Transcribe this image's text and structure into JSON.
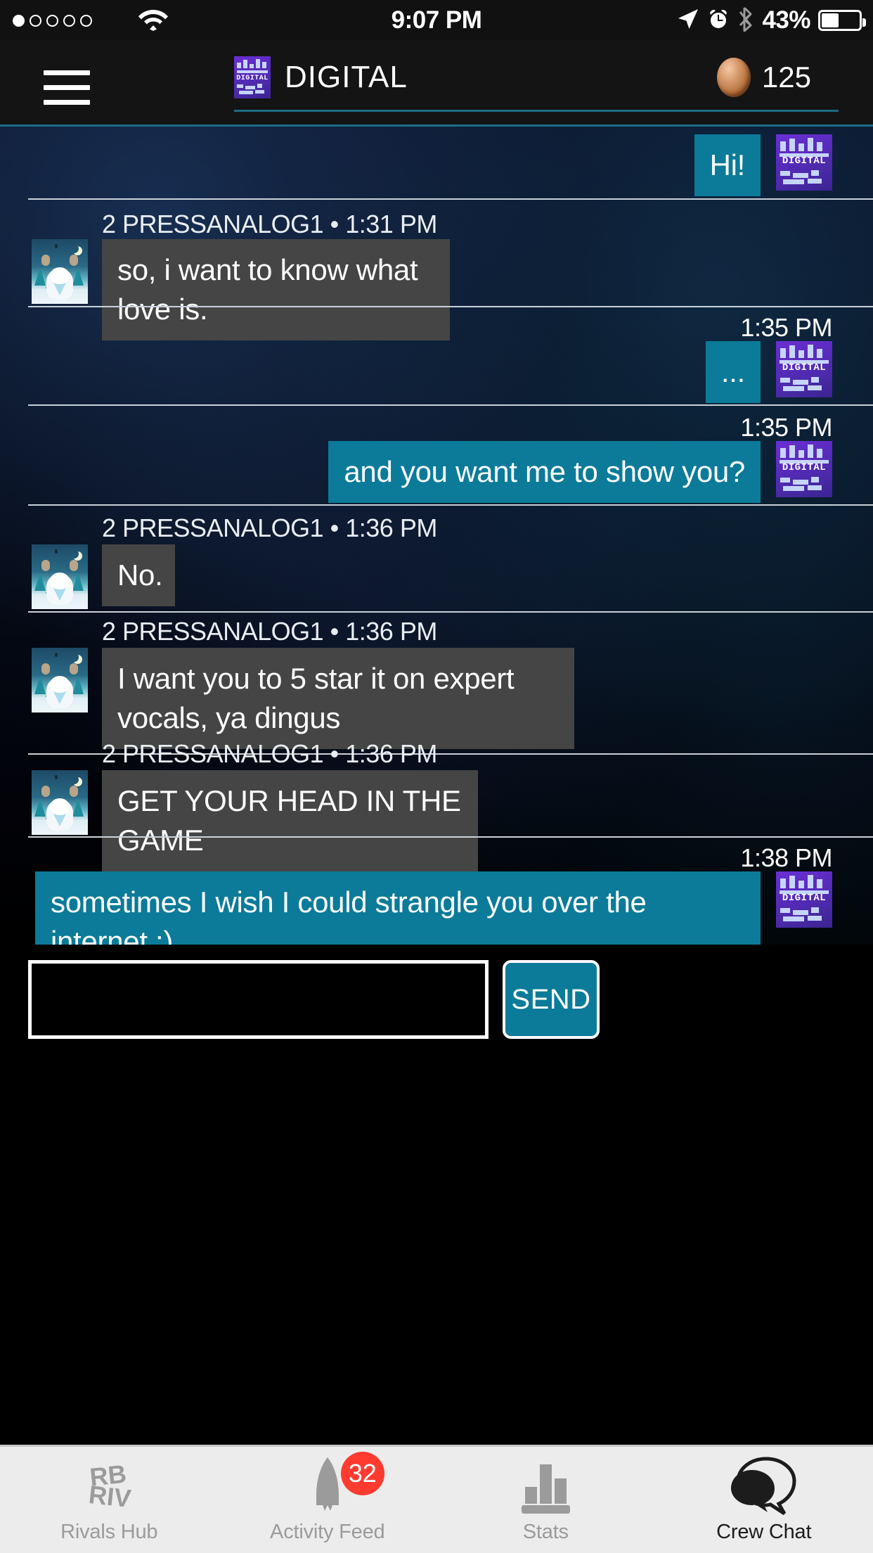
{
  "status_bar": {
    "signal_dots_total": 5,
    "signal_dots_filled": 1,
    "wifi_icon": "wifi-icon",
    "time": "9:07 PM",
    "location_icon": "location-arrow-icon",
    "alarm_icon": "alarm-clock-icon",
    "bluetooth_icon": "bluetooth-icon",
    "battery_percent": "43%",
    "battery_level": 43
  },
  "header": {
    "menu_icon": "hamburger-menu-icon",
    "crew_badge_label": "DIGITAL",
    "crew_name": "DIGITAL",
    "coin_icon": "coin-icon",
    "coin_count": "125",
    "accent_color": "#1d6c85"
  },
  "chat": {
    "own_bubble_color": "#0b7b99",
    "other_bubble_color": "#454545",
    "own_avatar_label": "DIGITAL",
    "messages": [
      {
        "side": "right",
        "sender": "DIGITAL",
        "timestamp": "",
        "meta": "",
        "text": "Hi!",
        "avatar": "digital-crew-avatar"
      },
      {
        "side": "left",
        "sender": "2 PRESSANALOG1",
        "timestamp": "1:31 PM",
        "meta": "2 PRESSANALOG1 • 1:31 PM",
        "text": "so, i want to know what love is.",
        "avatar": "yeti-avatar"
      },
      {
        "side": "right",
        "sender": "DIGITAL",
        "timestamp": "1:35 PM",
        "meta": "1:35 PM",
        "text": "...",
        "avatar": "digital-crew-avatar"
      },
      {
        "side": "right",
        "sender": "DIGITAL",
        "timestamp": "1:35 PM",
        "meta": "1:35 PM",
        "text": "and you want me to show you?",
        "avatar": "digital-crew-avatar"
      },
      {
        "side": "left",
        "sender": "2 PRESSANALOG1",
        "timestamp": "1:36 PM",
        "meta": "2 PRESSANALOG1 • 1:36 PM",
        "text": "No.",
        "avatar": "yeti-avatar"
      },
      {
        "side": "left",
        "sender": "2 PRESSANALOG1",
        "timestamp": "1:36 PM",
        "meta": "2 PRESSANALOG1 • 1:36 PM",
        "text": "I want you to 5 star it on expert vocals, ya dingus",
        "avatar": "yeti-avatar"
      },
      {
        "side": "left",
        "sender": "2 PRESSANALOG1",
        "timestamp": "1:36 PM",
        "meta": "2 PRESSANALOG1 • 1:36 PM",
        "text": "GET YOUR HEAD IN THE GAME",
        "avatar": "yeti-avatar"
      },
      {
        "side": "right",
        "sender": "DIGITAL",
        "timestamp": "1:38 PM",
        "meta": "1:38 PM",
        "text": "sometimes I wish I could strangle you over the internet :)",
        "avatar": "digital-crew-avatar"
      }
    ]
  },
  "composer": {
    "input_value": "",
    "input_placeholder": "",
    "send_label": "SEND"
  },
  "tabbar": {
    "items": [
      {
        "label": "Rivals Hub",
        "icon": "rivals-hub-icon",
        "badge": "",
        "active": false
      },
      {
        "label": "Activity Feed",
        "icon": "rocket-icon",
        "badge": "32",
        "active": false
      },
      {
        "label": "Stats",
        "icon": "bar-chart-icon",
        "badge": "",
        "active": false
      },
      {
        "label": "Crew Chat",
        "icon": "speech-bubbles-icon",
        "badge": "",
        "active": true
      }
    ],
    "badge_color": "#ff3b30"
  }
}
